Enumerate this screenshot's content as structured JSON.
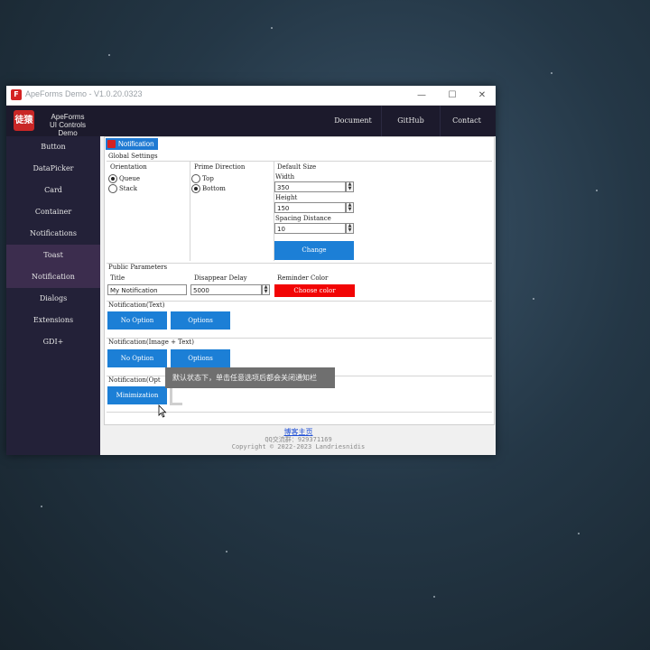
{
  "window": {
    "title": "ApeForms Demo - V1.0.20.0323",
    "app_icon_text": "ape",
    "controls": {
      "minimize": "—",
      "maximize": "☐",
      "close": "✕"
    }
  },
  "header": {
    "logo_text": "徒猿",
    "brand_line1": "ApeForms",
    "brand_line2": "UI Controls Demo",
    "nav": [
      "Document",
      "GitHub",
      "Contact"
    ]
  },
  "sidebar": {
    "items": [
      "Button",
      "DataPicker",
      "Card",
      "Container",
      "Notifications",
      "Toast",
      "Notification",
      "Dialogs",
      "Extensions",
      "GDI+"
    ],
    "active_index": 5,
    "highlighted_index": 6
  },
  "tab": {
    "label": "Notification"
  },
  "global_settings": {
    "title": "Global Settings",
    "orientation": {
      "label": "Orientation",
      "options": [
        "Queue",
        "Stack"
      ],
      "selected": "Queue"
    },
    "prime_direction": {
      "label": "Prime Direction",
      "options": [
        "Top",
        "Bottom"
      ],
      "selected": "Bottom"
    },
    "default_size": {
      "label": "Default Size",
      "width_label": "Width",
      "width_value": "350",
      "height_label": "Height",
      "height_value": "150",
      "spacing_label": "Spacing Distance",
      "spacing_value": "10",
      "button": "Change"
    }
  },
  "public_parameters": {
    "title": "Public Parameters",
    "title_label": "Title",
    "title_value": "My Notification",
    "delay_label": "Disappear Delay",
    "delay_value": "5000",
    "color_label": "Reminder Color",
    "color_button": "Choose color"
  },
  "section_text": {
    "title": "Notification(Text)",
    "no_option": "No Option",
    "options": "Options"
  },
  "section_image_text": {
    "title": "Notification(Image + Text)",
    "no_option": "No Option",
    "options": "Options"
  },
  "section_opt": {
    "title": "Notification(Opt",
    "minimization": "Minimization"
  },
  "tooltip": {
    "text": "默认状态下，单击任意选项后都会关闭通知栏"
  },
  "footer": {
    "link": "博客主页",
    "qq": "QQ交流群：929371169",
    "copyright": "Copyright © 2022-2023 Landriesnidis"
  },
  "colors": {
    "accent_blue": "#1c7fd6",
    "header_dark": "#1c1a2c",
    "sidebar_dark": "#232138",
    "reminder_red": "#f20505"
  }
}
